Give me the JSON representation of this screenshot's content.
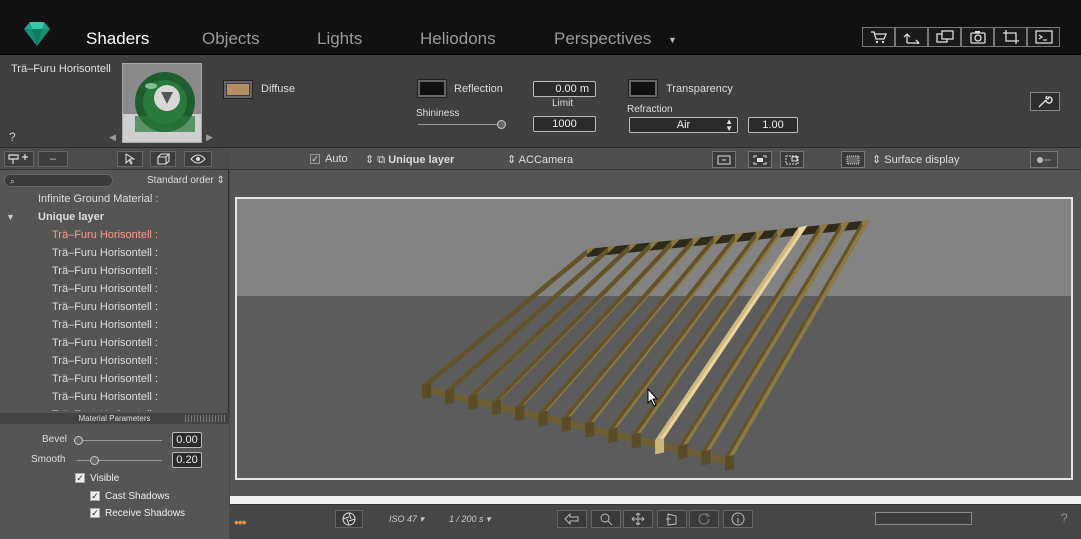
{
  "topbar": {
    "tabs": [
      "Shaders",
      "Objects",
      "Lights",
      "Heliodons",
      "Perspectives"
    ],
    "active_tab": "Shaders",
    "tools": [
      "cart-icon",
      "export-icon",
      "windows-icon",
      "camera-icon",
      "crop-icon",
      "console-icon"
    ]
  },
  "material": {
    "name": "Trä–Furu Horisontell",
    "help": "?",
    "diffuse_label": "Diffuse",
    "diffuse_color": "#b58e63",
    "reflection_label": "Reflection",
    "reflection_value": "0.00 m",
    "limit_label": "Limit",
    "shininess_label": "Shininess",
    "shininess_value": 1.0,
    "limit_value": "1000",
    "transparency_label": "Transparency",
    "refraction_label": "Refraction",
    "refraction_medium": "Air",
    "refraction_value": "1.00"
  },
  "sidebar": {
    "order_label": "Standard order",
    "tree": [
      {
        "label": "Infinite Ground Material :",
        "bold": false
      },
      {
        "label": "Unique layer",
        "bold": true
      },
      {
        "label": "Trä–Furu Horisontell :",
        "selected": true
      },
      {
        "label": "Trä–Furu Horisontell :"
      },
      {
        "label": "Trä–Furu Horisontell :"
      },
      {
        "label": "Trä–Furu Horisontell :"
      },
      {
        "label": "Trä–Furu Horisontell :"
      },
      {
        "label": "Trä–Furu Horisontell :"
      },
      {
        "label": "Trä–Furu Horisontell :"
      },
      {
        "label": "Trä–Furu Horisontell :"
      },
      {
        "label": "Trä–Furu Horisontell :"
      },
      {
        "label": "Trä–Furu Horisontell :"
      },
      {
        "label": "Trä–Furu Horisontell :"
      }
    ],
    "params_header": "Material Parameters",
    "bevel_label": "Bevel",
    "bevel_value": "0.00",
    "smooth_label": "Smooth",
    "smooth_value": "0.20",
    "visible_label": "Visible",
    "cast_shadows_label": "Cast Shadows",
    "receive_shadows_label": "Receive Shadows"
  },
  "viewbar": {
    "auto_label": "Auto",
    "layer_label": "Unique layer",
    "camera_label": "ACCamera",
    "display_label": "Surface display"
  },
  "statusbar": {
    "iso": "ISO 47",
    "shutter": "1 / 200 s",
    "help": "?"
  }
}
